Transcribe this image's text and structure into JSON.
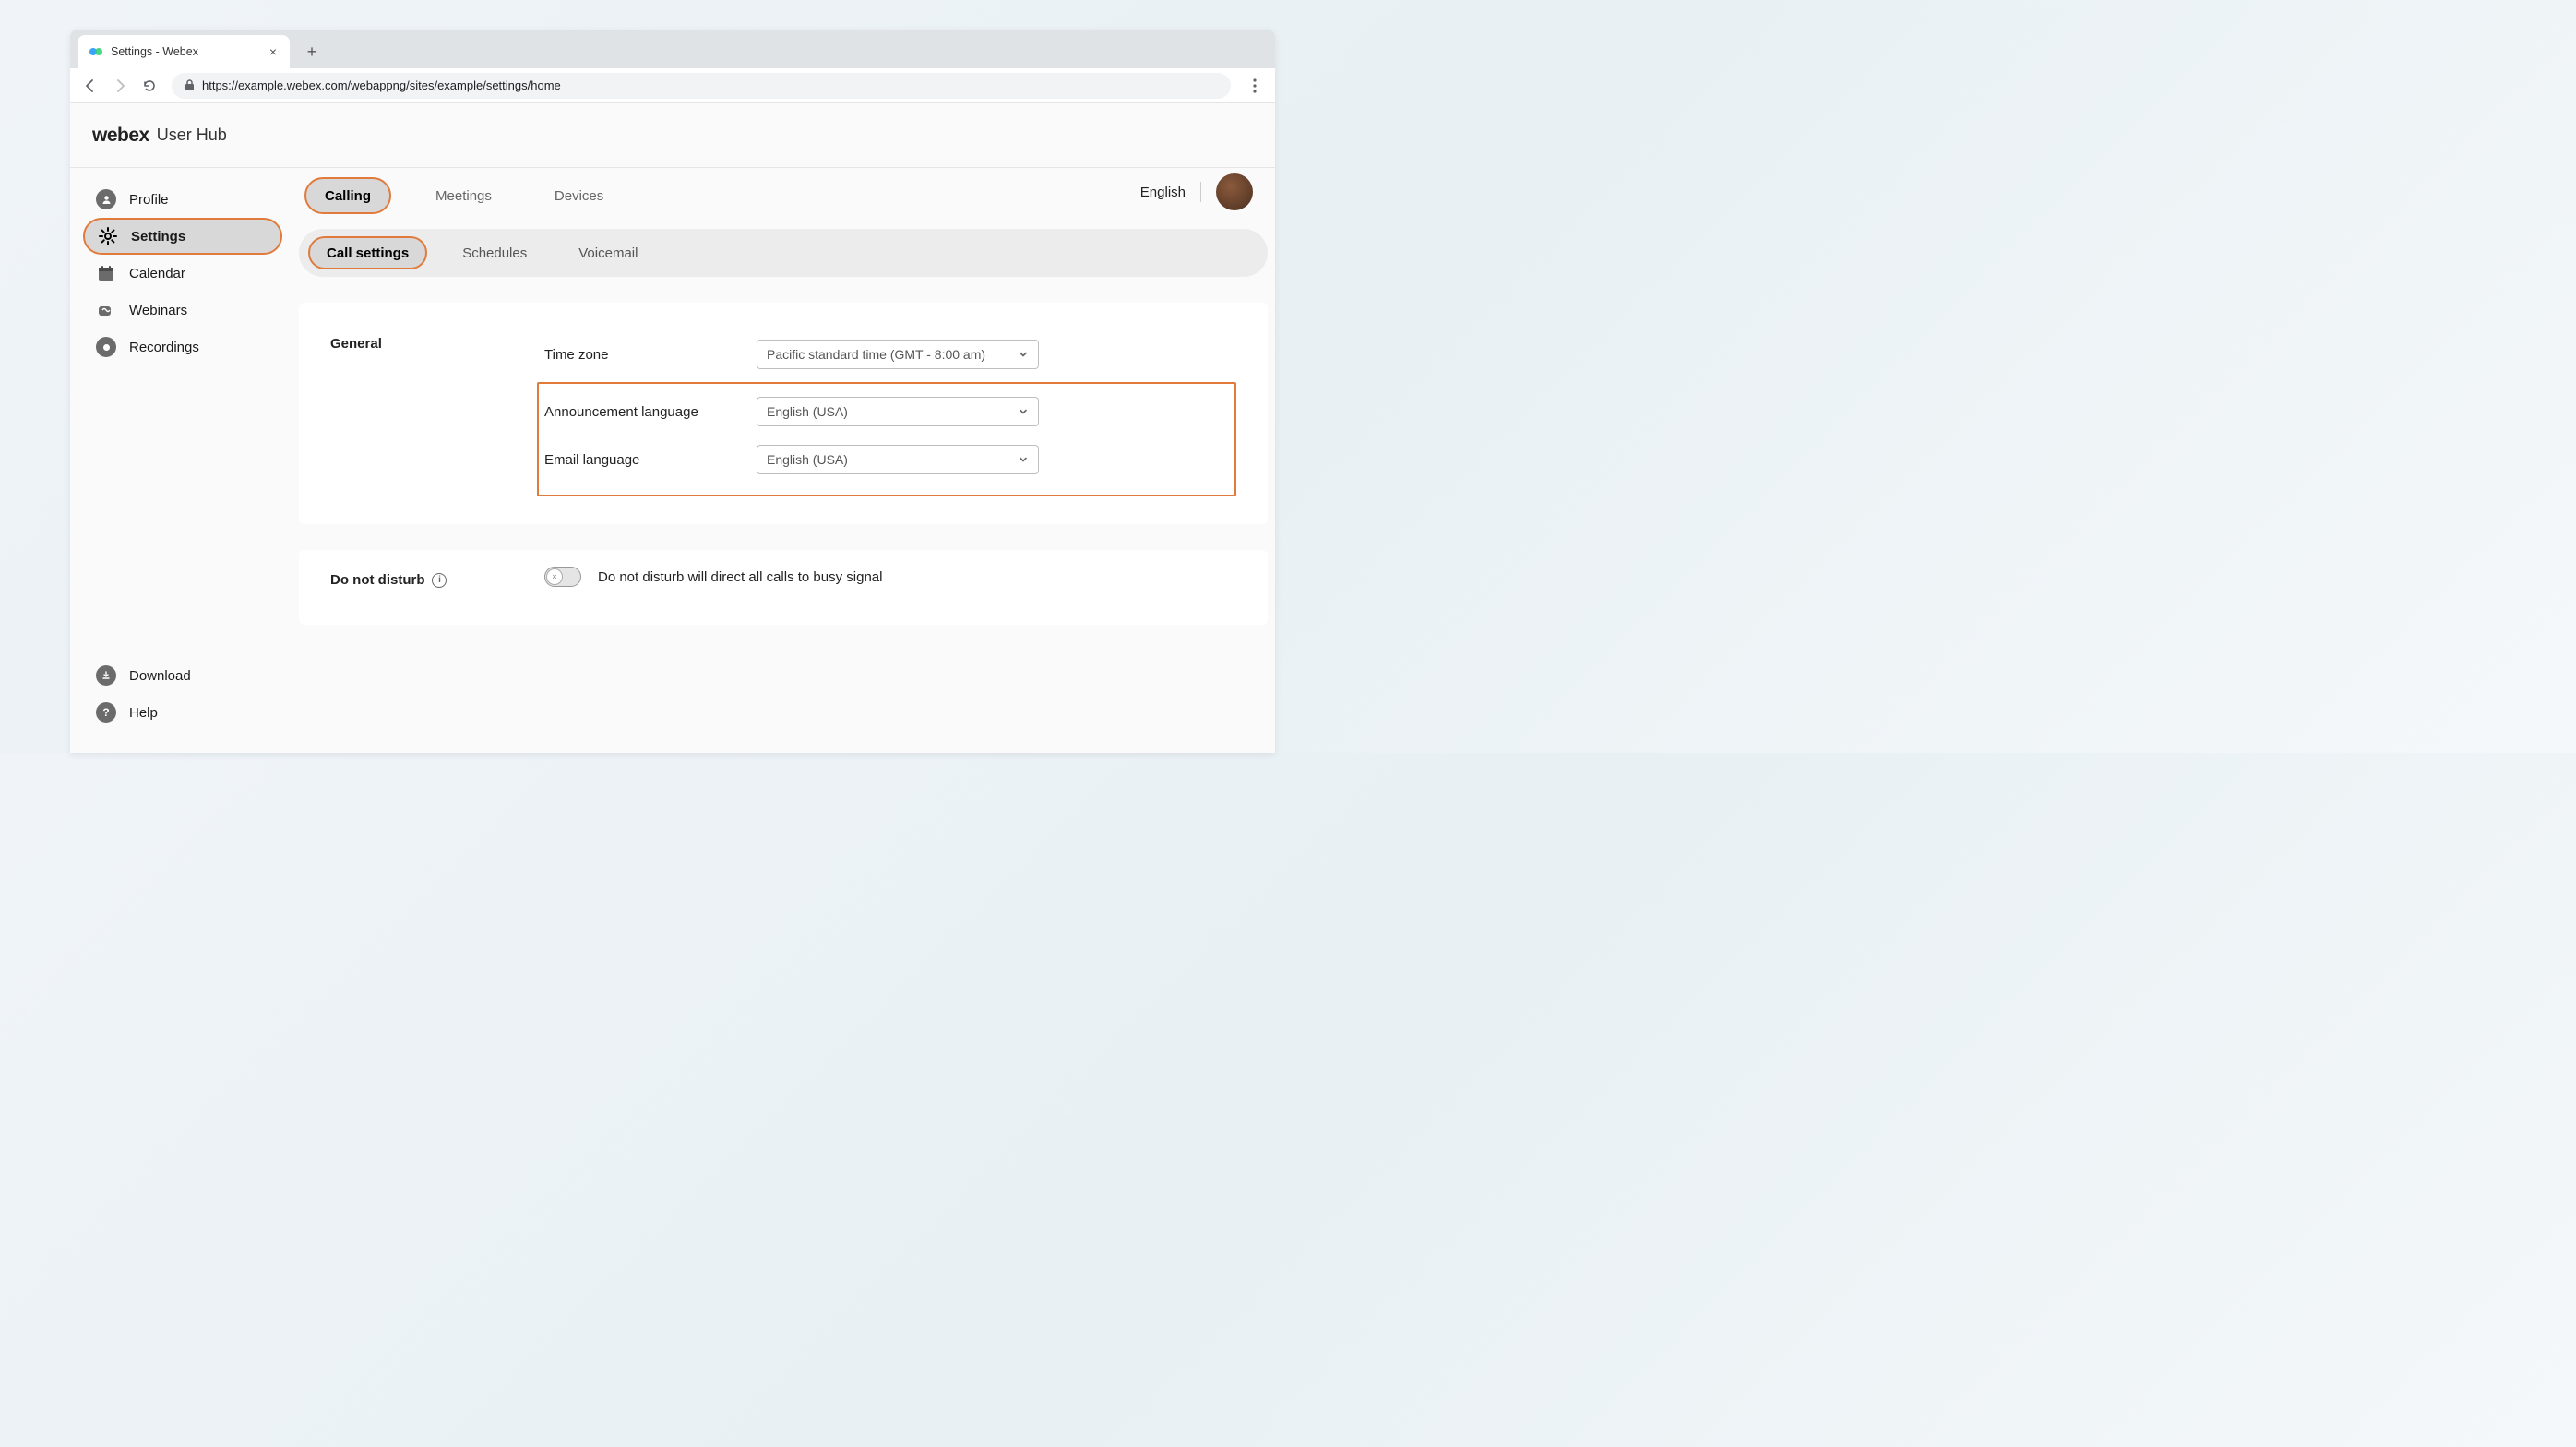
{
  "browser": {
    "tab_title": "Settings - Webex",
    "url": "https://example.webex.com/webappng/sites/example/settings/home"
  },
  "brand": {
    "logo": "webex",
    "sub": "User Hub"
  },
  "top_right": {
    "language": "English"
  },
  "sidebar": {
    "items": [
      {
        "label": "Profile"
      },
      {
        "label": "Settings"
      },
      {
        "label": "Calendar"
      },
      {
        "label": "Webinars"
      },
      {
        "label": "Recordings"
      }
    ],
    "bottom": [
      {
        "label": "Download"
      },
      {
        "label": "Help"
      }
    ]
  },
  "tabs": {
    "primary": [
      {
        "label": "Calling"
      },
      {
        "label": "Meetings"
      },
      {
        "label": "Devices"
      }
    ],
    "secondary": [
      {
        "label": "Call settings"
      },
      {
        "label": "Schedules"
      },
      {
        "label": "Voicemail"
      }
    ]
  },
  "general": {
    "title": "General",
    "timezone_label": "Time zone",
    "timezone_value": "Pacific standard time (GMT - 8:00 am)",
    "announcement_label": "Announcement language",
    "announcement_value": "English (USA)",
    "email_label": "Email language",
    "email_value": "English (USA)"
  },
  "dnd": {
    "title": "Do not disturb",
    "description": "Do not disturb will direct all calls to busy signal"
  }
}
